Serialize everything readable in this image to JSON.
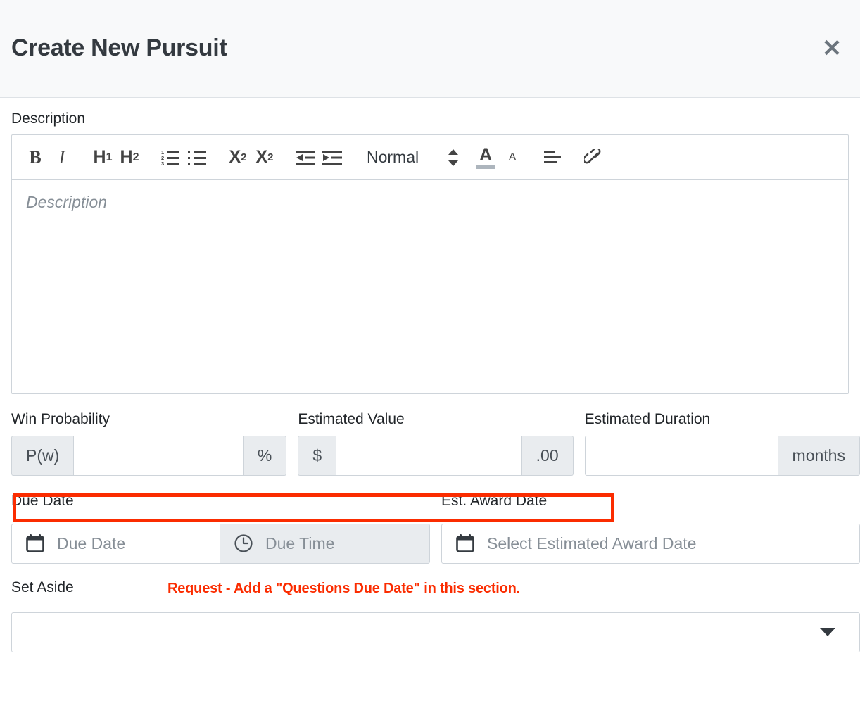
{
  "header": {
    "title": "Create New Pursuit",
    "close_label": "✕"
  },
  "description": {
    "label": "Description",
    "placeholder": "Description",
    "toolbar": {
      "bold": "B",
      "italic": "I",
      "heading1": "H",
      "heading1_sub": "1",
      "heading2": "H",
      "heading2_sub": "2",
      "ordered_list_icon": "ordered-list-icon",
      "bullet_list_icon": "bullet-list-icon",
      "subscript": "X",
      "subscript_sub": "2",
      "superscript": "X",
      "superscript_sup": "2",
      "outdent_icon": "outdent-icon",
      "indent_icon": "indent-icon",
      "format_value": "Normal",
      "text_color": "A",
      "background_color": "A",
      "align_icon": "align-left-icon",
      "link_icon": "link-icon"
    }
  },
  "win_probability": {
    "label": "Win Probability",
    "prefix": "P(w)",
    "suffix": "%",
    "value": "",
    "placeholder": ""
  },
  "estimated_value": {
    "label": "Estimated Value",
    "prefix": "$",
    "suffix": ".00",
    "value": "",
    "placeholder": ""
  },
  "estimated_duration": {
    "label": "Estimated Duration",
    "suffix": "months",
    "value": "",
    "placeholder": ""
  },
  "dates": {
    "due_date_label": "Due Date",
    "award_date_label": "Est. Award Date",
    "due_date_placeholder": "Due Date",
    "due_time_placeholder": "Due Time",
    "award_date_placeholder": "Select Estimated Award Date",
    "highlight_color": "#fb2c00"
  },
  "set_aside": {
    "label": "Set Aside",
    "selected": "",
    "caret": "chevron-down-icon"
  },
  "annotation": {
    "text": "Request - Add a \"Questions Due Date\" in this section.",
    "color": "#fb2c00"
  }
}
